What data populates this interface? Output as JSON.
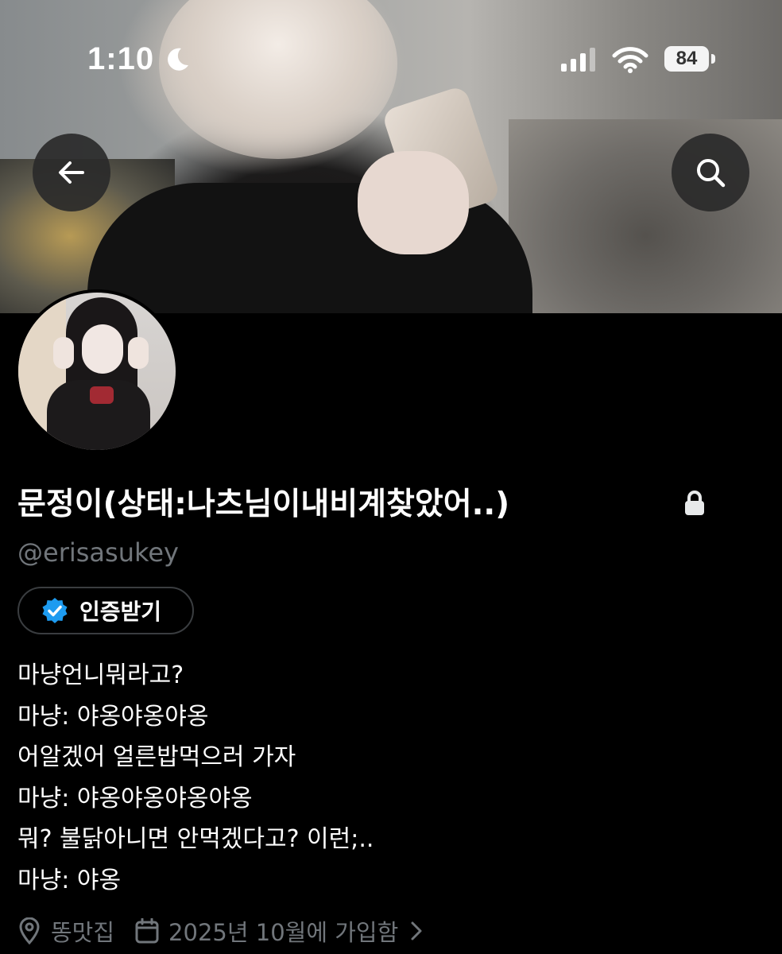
{
  "status_bar": {
    "time": "1:10",
    "battery_percent": "84",
    "icons": [
      "moon-icon",
      "signal-icon",
      "wifi-icon",
      "battery-icon"
    ]
  },
  "header": {
    "back_icon": "arrow-left-icon",
    "search_icon": "search-icon"
  },
  "profile": {
    "display_name": "문정이(상태:나츠님이내비계찾았어..)",
    "protected_icon": "lock-icon",
    "handle": "@erisasukey",
    "verify_button_label": "인증받기",
    "bio_lines": [
      "마냥언니뭐라고?",
      "마냥: 야옹야옹야옹",
      "어알겠어 얼른밥먹으러 가자",
      "마냥: 야옹야옹야옹야옹",
      "뭐? 불닭아니면 안먹겠다고? 이런;..",
      "마냥: 야옹"
    ],
    "location": "똥맛집",
    "joined": "2025년 10월에 가입함"
  },
  "colors": {
    "background": "#000000",
    "secondary_text": "#71767b",
    "verified_blue": "#1d9bf0"
  }
}
